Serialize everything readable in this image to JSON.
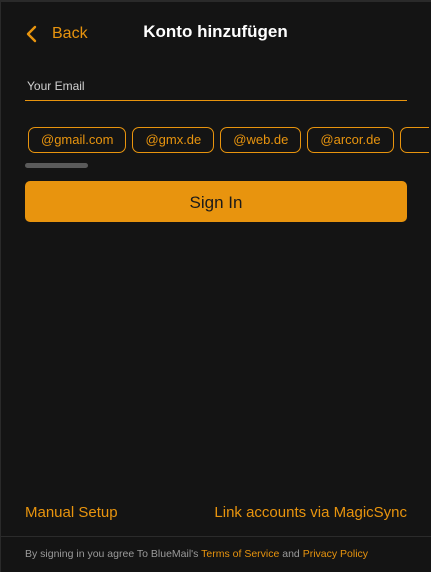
{
  "header": {
    "back_label": "Back",
    "title": "Konto hinzufügen"
  },
  "email": {
    "placeholder": "Your Email",
    "value": ""
  },
  "domains": [
    "@gmail.com",
    "@gmx.de",
    "@web.de",
    "@arcor.de"
  ],
  "signin": {
    "label": "Sign In"
  },
  "links": {
    "manual_setup": "Manual Setup",
    "magicsync": "Link accounts via MagicSync"
  },
  "footer": {
    "prefix": "By signing in you agree To BlueMail's ",
    "terms": "Terms of Service",
    "and": " and ",
    "privacy": "Privacy Policy"
  },
  "colors": {
    "accent": "#e8940e",
    "background": "#141414",
    "text": "#ffffff",
    "muted": "#9a9a9a"
  },
  "icons": {
    "back": "chevron-left-icon"
  }
}
